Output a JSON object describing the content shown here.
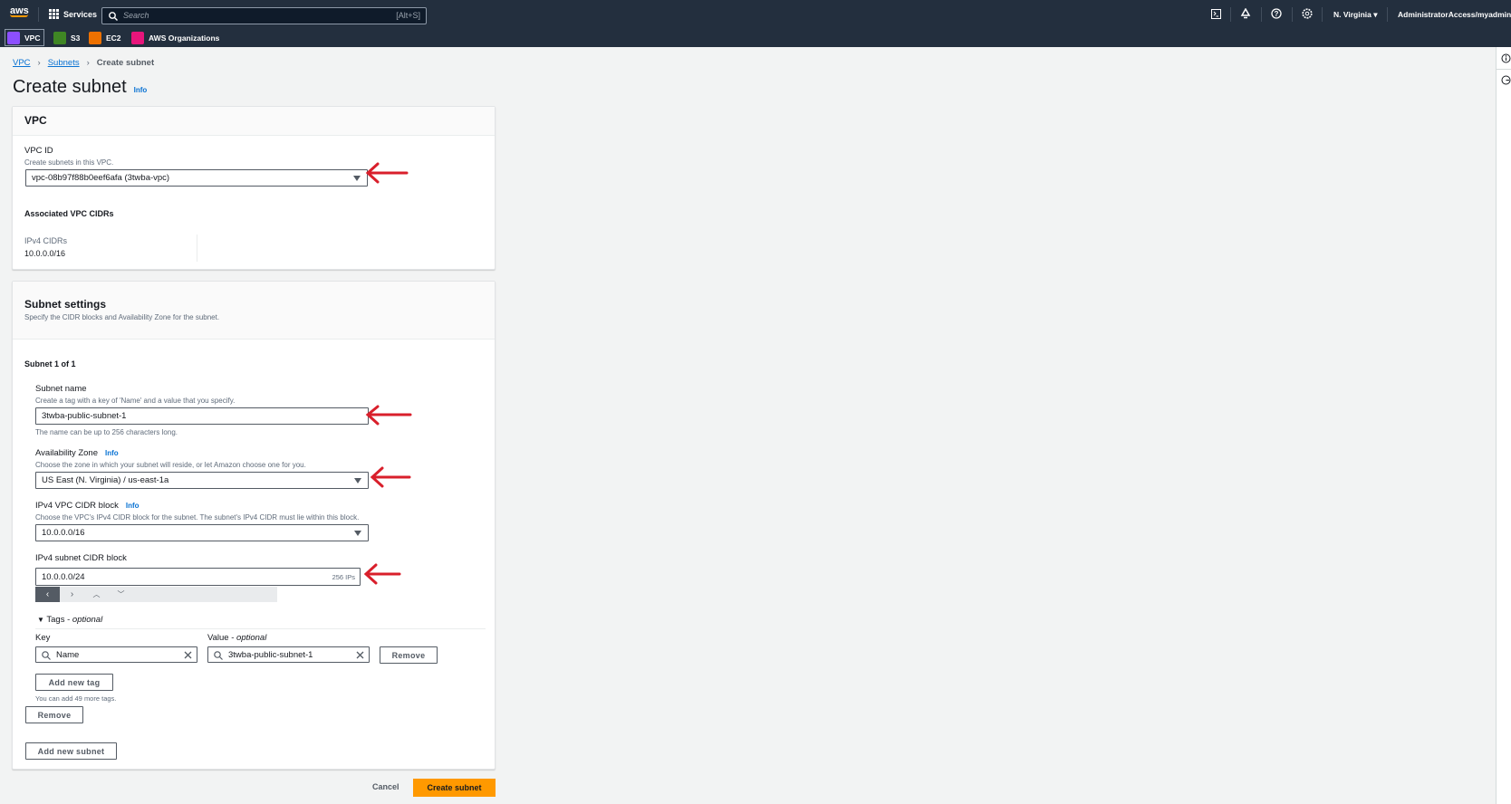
{
  "topbar": {
    "logo": "aws",
    "services": "Services",
    "search_placeholder": "Search",
    "search_shortcut": "[Alt+S]",
    "region": "N. Virginia",
    "account": "AdministratorAccess/myadmin",
    "favorites": [
      {
        "label": "VPC",
        "color": "#8c4fff"
      },
      {
        "label": "S3",
        "color": "#3f8624"
      },
      {
        "label": "EC2",
        "color": "#ed7100"
      },
      {
        "label": "AWS Organizations",
        "color": "#e7157b"
      }
    ]
  },
  "breadcrumb": {
    "items": [
      "VPC",
      "Subnets",
      "Create subnet"
    ]
  },
  "page": {
    "title": "Create subnet",
    "info": "Info"
  },
  "vpc_panel": {
    "title": "VPC",
    "vpc_id_label": "VPC ID",
    "vpc_id_desc": "Create subnets in this VPC.",
    "vpc_id_value": "vpc-08b97f88b0eef6afa (3twba-vpc)",
    "assoc_title": "Associated VPC CIDRs",
    "ipv4_label": "IPv4 CIDRs",
    "ipv4_value": "10.0.0.0/16"
  },
  "subnet_panel": {
    "title": "Subnet settings",
    "desc": "Specify the CIDR blocks and Availability Zone for the subnet.",
    "subnet_heading": "Subnet 1 of 1",
    "name_label": "Subnet name",
    "name_desc": "Create a tag with a key of 'Name' and a value that you specify.",
    "name_value": "3twba-public-subnet-1",
    "name_hint": "The name can be up to 256 characters long.",
    "az_label": "Availability Zone",
    "az_info": "Info",
    "az_desc": "Choose the zone in which your subnet will reside, or let Amazon choose one for you.",
    "az_value": "US East (N. Virginia) / us-east-1a",
    "vpc_cidr_label": "IPv4 VPC CIDR block",
    "vpc_cidr_info": "Info",
    "vpc_cidr_desc": "Choose the VPC's IPv4 CIDR block for the subnet. The subnet's IPv4 CIDR must lie within this block.",
    "vpc_cidr_value": "10.0.0.0/16",
    "subnet_cidr_label": "IPv4 subnet CIDR block",
    "subnet_cidr_value": "10.0.0.0/24",
    "subnet_cidr_count": "256 IPs",
    "tags_title": "Tags - ",
    "tags_optional": "optional",
    "key_label": "Key",
    "value_label": "Value - ",
    "value_optional": "optional",
    "tag_key": "Name",
    "tag_value": "3twba-public-subnet-1",
    "remove_tag": "Remove",
    "add_tag": "Add new tag",
    "tags_hint": "You can add 49 more tags.",
    "remove_subnet": "Remove",
    "add_subnet": "Add new subnet"
  },
  "footer": {
    "cancel": "Cancel",
    "create": "Create subnet",
    "accent": "#ff9900"
  }
}
